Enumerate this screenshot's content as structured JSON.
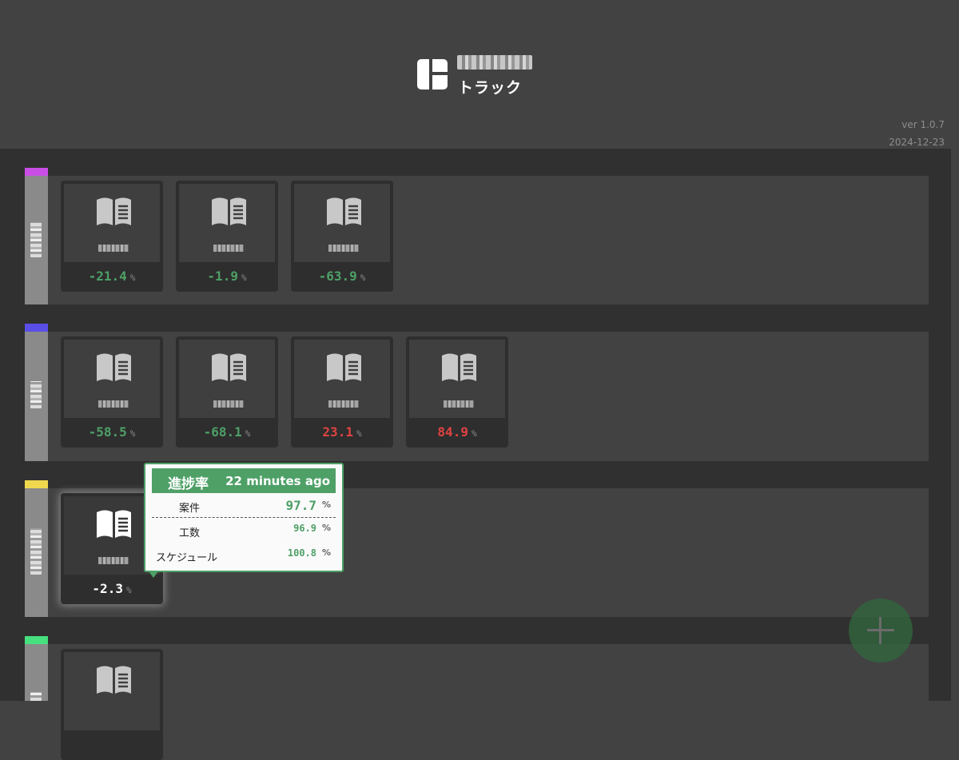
{
  "header": {
    "app_subtitle": "トラック",
    "version": "ver 1.0.7",
    "date": "2024-12-23"
  },
  "groups": [
    {
      "color": "#c94ee6",
      "cards": [
        {
          "value": "-21.4",
          "unit": "%",
          "tone": "green"
        },
        {
          "value": "-1.9",
          "unit": "%",
          "tone": "green"
        },
        {
          "value": "-63.9",
          "unit": "%",
          "tone": "green"
        }
      ]
    },
    {
      "color": "#5a4ee8",
      "cards": [
        {
          "value": "-58.5",
          "unit": "%",
          "tone": "green"
        },
        {
          "value": "-68.1",
          "unit": "%",
          "tone": "green"
        },
        {
          "value": "23.1",
          "unit": "%",
          "tone": "red"
        },
        {
          "value": "84.9",
          "unit": "%",
          "tone": "red"
        }
      ]
    },
    {
      "color": "#f0d84e",
      "cards": [
        {
          "value": "-2.3",
          "unit": "%",
          "tone": "white"
        }
      ]
    },
    {
      "color": "#46e07e",
      "cards": []
    }
  ],
  "tooltip": {
    "title": "進捗率",
    "time": "22 minutes ago",
    "rows": [
      {
        "label": "案件",
        "value": "97.7",
        "unit": "%"
      },
      {
        "label": "工数",
        "value": "96.9",
        "unit": "%"
      },
      {
        "label": "スケジュール",
        "value": "100.8",
        "unit": "%"
      }
    ]
  },
  "icons": {
    "logo": "app-logo-icon",
    "card": "open-book-icon",
    "fab": "plus-icon"
  }
}
